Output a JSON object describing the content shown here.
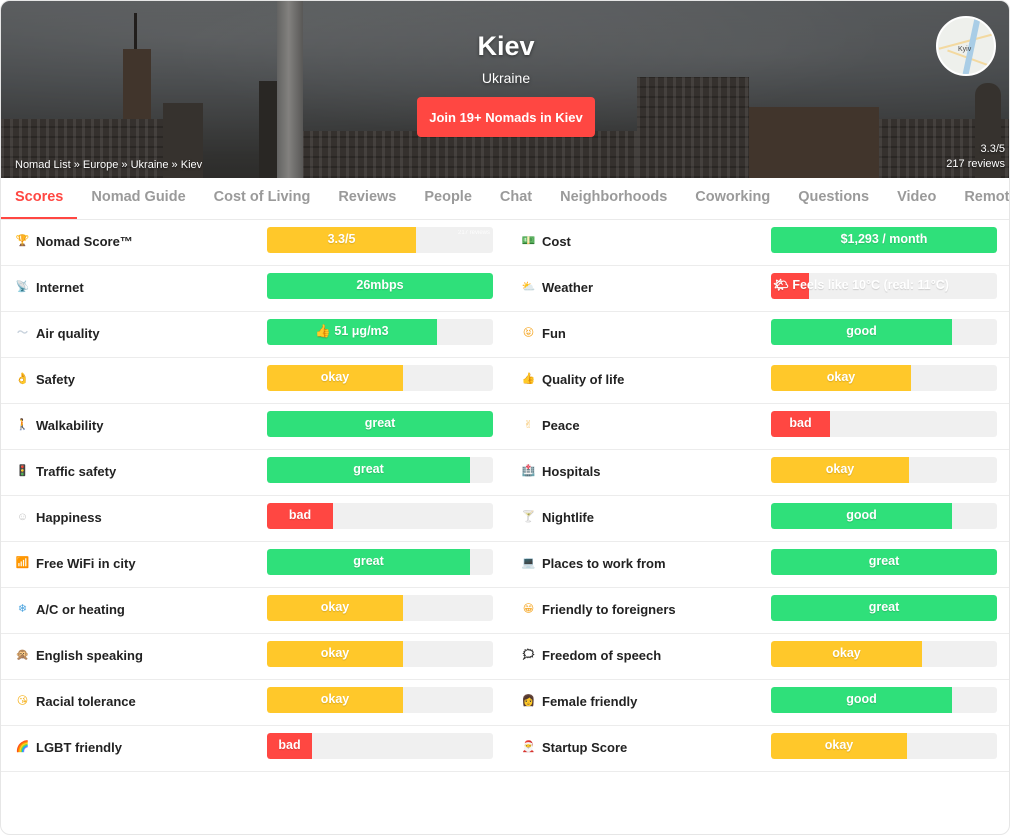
{
  "colors": {
    "accent": "#ff4742",
    "good": "#2fe07a",
    "okay": "#ffc82a",
    "bad": "#ff4742",
    "track": "#f0f0f0"
  },
  "hero": {
    "city": "Kiev",
    "country": "Ukraine",
    "join_label": "Join 19+ Nomads in Kiev",
    "breadcrumb": [
      "Nomad List",
      "Europe",
      "Ukraine",
      "Kiev"
    ],
    "breadcrumb_sep": " » ",
    "rating": "3.3/5",
    "reviews": "217 reviews",
    "map_label": "Kyiv"
  },
  "tabs": [
    "Scores",
    "Nomad Guide",
    "Cost of Living",
    "Reviews",
    "People",
    "Chat",
    "Neighborhoods",
    "Coworking",
    "Questions",
    "Video",
    "Remote"
  ],
  "scores_left": [
    {
      "label": "Nomad Score™",
      "icon": "trophy-icon",
      "text": "3.3/5",
      "level": 0.66,
      "status": "okay",
      "note": "217 reviews"
    },
    {
      "label": "Internet",
      "icon": "satellite-icon",
      "text": "26mbps",
      "level": 1.0,
      "status": "good"
    },
    {
      "label": "Air quality",
      "icon": "wind-icon",
      "text": "👍 51 μg/m3",
      "level": 0.75,
      "status": "good"
    },
    {
      "label": "Safety",
      "icon": "ok-hand-icon",
      "text": "okay",
      "level": 0.6,
      "status": "okay"
    },
    {
      "label": "Walkability",
      "icon": "walking-icon",
      "text": "great",
      "level": 1.0,
      "status": "good"
    },
    {
      "label": "Traffic safety",
      "icon": "traffic-light-icon",
      "text": "great",
      "level": 0.9,
      "status": "good"
    },
    {
      "label": "Happiness",
      "icon": "smile-icon",
      "text": "bad",
      "level": 0.29,
      "status": "bad"
    },
    {
      "label": "Free WiFi in city",
      "icon": "signal-icon",
      "text": "great",
      "level": 0.9,
      "status": "good"
    },
    {
      "label": "A/C or heating",
      "icon": "snowflake-icon",
      "text": "okay",
      "level": 0.6,
      "status": "okay"
    },
    {
      "label": "English speaking",
      "icon": "monkey-icon",
      "text": "okay",
      "level": 0.6,
      "status": "okay"
    },
    {
      "label": "Racial tolerance",
      "icon": "kiss-face-icon",
      "text": "okay",
      "level": 0.6,
      "status": "okay"
    },
    {
      "label": "LGBT friendly",
      "icon": "rainbow-icon",
      "text": "bad",
      "level": 0.2,
      "status": "bad"
    }
  ],
  "scores_right": [
    {
      "label": "Cost",
      "icon": "money-icon",
      "text": "$1,293 / month",
      "level": 1.0,
      "status": "good"
    },
    {
      "label": "Weather",
      "icon": "cloud-sun-icon",
      "text": "🌤 Feels like 10°C (real: 11°C)",
      "level": 0.17,
      "status": "bad"
    },
    {
      "label": "Fun",
      "icon": "grin-icon",
      "text": "good",
      "level": 0.8,
      "status": "good"
    },
    {
      "label": "Quality of life",
      "icon": "thumbs-up-icon",
      "text": "okay",
      "level": 0.62,
      "status": "okay"
    },
    {
      "label": "Peace",
      "icon": "peace-hand-icon",
      "text": "bad",
      "level": 0.26,
      "status": "bad"
    },
    {
      "label": "Hospitals",
      "icon": "hospital-icon",
      "text": "okay",
      "level": 0.61,
      "status": "okay"
    },
    {
      "label": "Nightlife",
      "icon": "cocktail-icon",
      "text": "good",
      "level": 0.8,
      "status": "good"
    },
    {
      "label": "Places to work from",
      "icon": "laptop-icon",
      "text": "great",
      "level": 1.0,
      "status": "good"
    },
    {
      "label": "Friendly to foreigners",
      "icon": "smile-teeth-icon",
      "text": "great",
      "level": 1.0,
      "status": "good"
    },
    {
      "label": "Freedom of speech",
      "icon": "speech-icon",
      "text": "okay",
      "level": 0.67,
      "status": "okay"
    },
    {
      "label": "Female friendly",
      "icon": "woman-icon",
      "text": "good",
      "level": 0.8,
      "status": "good"
    },
    {
      "label": "Startup Score",
      "icon": "santa-icon",
      "text": "okay",
      "level": 0.6,
      "status": "okay"
    }
  ],
  "icon_glyphs": {
    "trophy-icon": {
      "g": "🏆",
      "bg": "#f0b429"
    },
    "satellite-icon": {
      "g": "📡",
      "bg": "#9aa5b1"
    },
    "wind-icon": {
      "g": "〜",
      "bg": "#c9d3dd"
    },
    "ok-hand-icon": {
      "g": "👌",
      "bg": "#f7c873"
    },
    "walking-icon": {
      "g": "🚶",
      "bg": "#5b7dbd"
    },
    "traffic-light-icon": {
      "g": "🚦",
      "bg": "#3b3b3b"
    },
    "smile-icon": {
      "g": "☺",
      "bg": "#c0c0c0"
    },
    "signal-icon": {
      "g": "📶",
      "bg": "#2b74c7"
    },
    "snowflake-icon": {
      "g": "❄",
      "bg": "#4aa3df"
    },
    "monkey-icon": {
      "g": "🙊",
      "bg": "#a0633c"
    },
    "kiss-face-icon": {
      "g": "😘",
      "bg": "#f5b321"
    },
    "rainbow-icon": {
      "g": "🌈",
      "bg": "#e74c3c"
    },
    "money-icon": {
      "g": "💵",
      "bg": "#4caf50"
    },
    "cloud-sun-icon": {
      "g": "⛅",
      "bg": "#f6c344"
    },
    "grin-icon": {
      "g": "😝",
      "bg": "#f5a623"
    },
    "thumbs-up-icon": {
      "g": "👍",
      "bg": "#f5b321"
    },
    "peace-hand-icon": {
      "g": "✌",
      "bg": "#f7c873"
    },
    "hospital-icon": {
      "g": "🏥",
      "bg": "#d9534f"
    },
    "cocktail-icon": {
      "g": "🍸",
      "bg": "#f2c94c"
    },
    "laptop-icon": {
      "g": "💻",
      "bg": "#777777"
    },
    "smile-teeth-icon": {
      "g": "😁",
      "bg": "#f5a623"
    },
    "speech-icon": {
      "g": "🗯",
      "bg": "#222222"
    },
    "woman-icon": {
      "g": "👩",
      "bg": "#c47a3a"
    },
    "santa-icon": {
      "g": "🎅",
      "bg": "#d9534f"
    }
  }
}
